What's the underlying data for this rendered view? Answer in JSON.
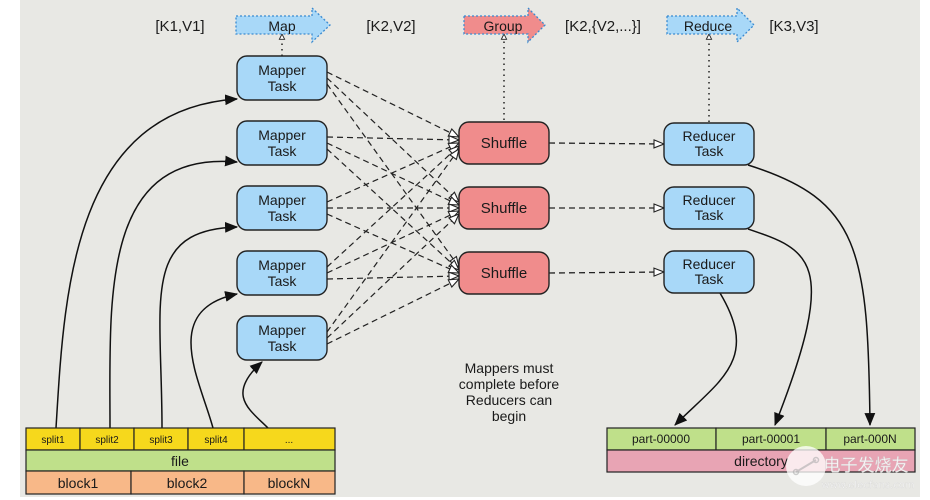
{
  "stages": {
    "input_kv": "[K1,V1]",
    "map": "Map",
    "map_out_kv": "[K2,V2]",
    "group": "Group",
    "group_out_kv": "[K2,{V2,...}]",
    "reduce": "Reduce",
    "reduce_out_kv": "[K3,V3]"
  },
  "mappers": [
    {
      "line1": "Mapper",
      "line2": "Task"
    },
    {
      "line1": "Mapper",
      "line2": "Task"
    },
    {
      "line1": "Mapper",
      "line2": "Task"
    },
    {
      "line1": "Mapper",
      "line2": "Task"
    },
    {
      "line1": "Mapper",
      "line2": "Task"
    }
  ],
  "shuffles": [
    "Shuffle",
    "Shuffle",
    "Shuffle"
  ],
  "reducers": [
    {
      "line1": "Reducer",
      "line2": "Task"
    },
    {
      "line1": "Reducer",
      "line2": "Task"
    },
    {
      "line1": "Reducer",
      "line2": "Task"
    }
  ],
  "note": [
    "Mappers must",
    "complete before",
    "Reducers can",
    "begin"
  ],
  "input": {
    "splits": [
      "split1",
      "split2",
      "split3",
      "split4",
      "..."
    ],
    "file": "file",
    "blocks": [
      "block1",
      "block2",
      "blockN"
    ]
  },
  "output": {
    "parts": [
      "part-00000",
      "part-00001",
      "part-000N"
    ],
    "directory": "directory"
  },
  "watermark": {
    "title": "电子发烧友",
    "url": "www.elecfans.com"
  },
  "colors": {
    "task_blue": "#a8d8f8",
    "shuffle_red": "#f08c8c",
    "split_yellow": "#f6d81c",
    "file_green": "#bfe08a",
    "block_orange": "#f8b888",
    "directory_pink": "#e8a4b4"
  }
}
